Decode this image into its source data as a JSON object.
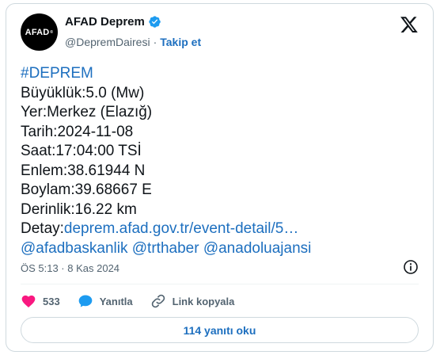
{
  "account": {
    "avatar_text": "AFAD",
    "avatar_mark": "®",
    "display_name": "AFAD Deprem",
    "handle": "@DepremDairesi",
    "separator": "·",
    "follow_label": "Takip et"
  },
  "tweet": {
    "lines": [
      {
        "text": "#DEPREM",
        "is_link": true
      },
      {
        "text": "Büyüklük:5.0 (Mw)",
        "is_link": false
      },
      {
        "text": "Yer:Merkez (Elazığ)",
        "is_link": false
      },
      {
        "text": "Tarih:2024-11-08",
        "is_link": false
      },
      {
        "text": "Saat:17:04:00 TSİ",
        "is_link": false
      },
      {
        "text": "Enlem:38.61944 N",
        "is_link": false
      },
      {
        "text": "Boylam:39.68667 E",
        "is_link": false
      },
      {
        "text": "Derinlik:16.22 km",
        "is_link": false
      }
    ],
    "detail_prefix": "Detay:",
    "detail_link": "deprem.afad.gov.tr/event-detail/5…",
    "mentions": [
      "@afadbaskanlik",
      "@trthaber",
      "@anadoluajansi"
    ],
    "timestamp": "ÖS 5:13 · 8 Kas 2024"
  },
  "actions": {
    "like_count": "533",
    "reply_label": "Yanıtla",
    "copy_link_label": "Link kopyala"
  },
  "read_replies_label": "114 yanıtı oku",
  "colors": {
    "link": "#1d6fbf",
    "like": "#f91880",
    "verified": "#1d9bf0"
  }
}
